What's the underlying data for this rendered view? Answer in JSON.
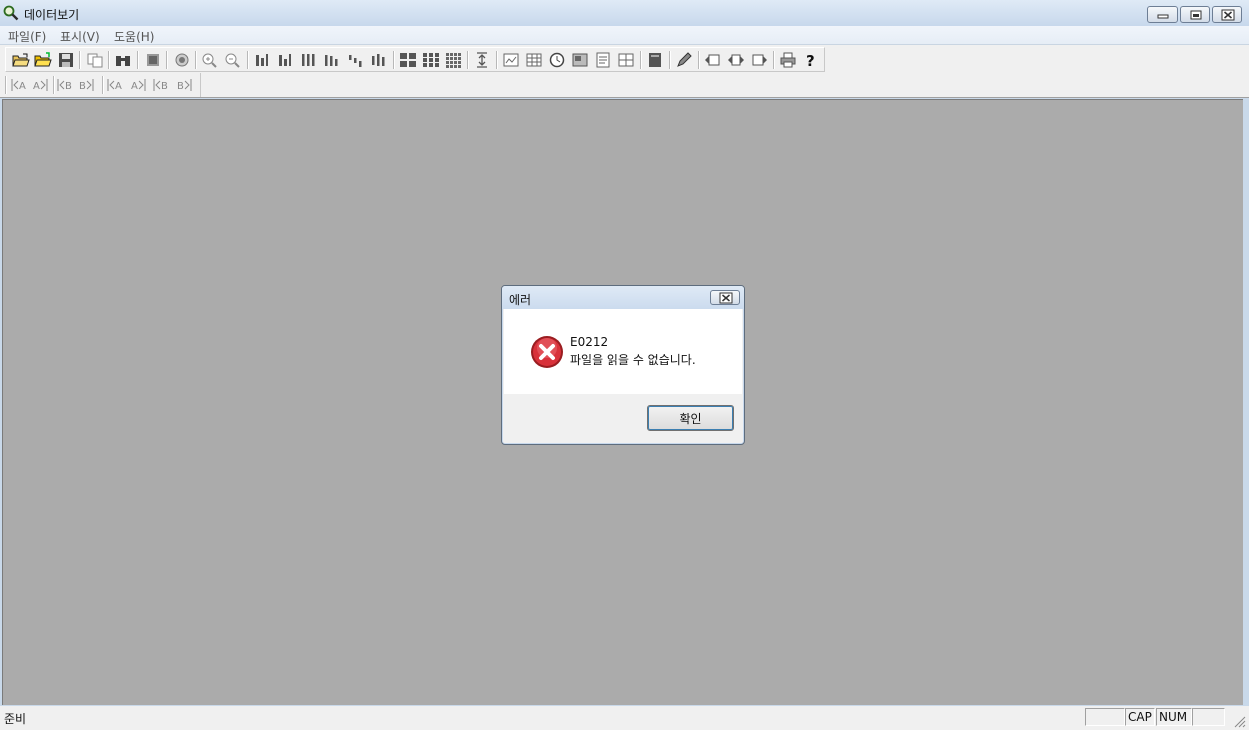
{
  "window": {
    "title": "데이터보기",
    "controls": [
      "minimize",
      "restore",
      "close"
    ]
  },
  "menu": {
    "items": [
      "파일(F)",
      "표시(V)",
      "도움(H)"
    ]
  },
  "toolbar1": {
    "icons": [
      "open-folder-icon",
      "open-folder-yellow-icon",
      "save-icon",
      "copy-icon",
      "binoculars-icon",
      "film-icon",
      "record-icon",
      "zoom-in-icon",
      "zoom-out-icon",
      "bar-chart-a-icon",
      "bar-chart-b-icon",
      "bars-vertical-icon",
      "bars-grouped-icon",
      "bars-stepped-icon",
      "bars-stacked-icon",
      "grid-2x2-icon",
      "grid-3x3-icon",
      "grid-4x4-icon",
      "vertical-expand-icon",
      "chart-frame-icon",
      "table-icon",
      "clock-icon",
      "image-icon",
      "document-icon",
      "layout-icon",
      "card-icon",
      "pencil-icon",
      "nav-left-icon",
      "nav-both-icon",
      "nav-right-icon",
      "printer-icon",
      "help-icon"
    ]
  },
  "toolbar2": {
    "buttons": [
      "|◀A",
      "A▶|",
      "|◀B",
      "B▶|",
      "|◀A",
      "A▶|",
      "|◀B",
      "B▶|"
    ]
  },
  "dialog": {
    "title": "에러",
    "code": "E0212",
    "message": "파일을 읽을 수 없습니다.",
    "ok_label": "확인",
    "icon": "error-icon"
  },
  "statusbar": {
    "text": "준비",
    "pane1": "",
    "cap": "CAP",
    "num": "NUM",
    "pane4": ""
  },
  "colors": {
    "client_bg": "#ababab",
    "error_red": "#c8232c"
  }
}
